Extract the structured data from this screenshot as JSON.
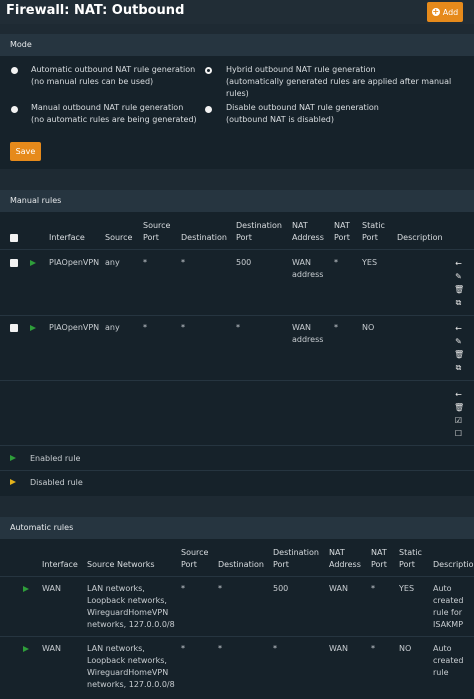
{
  "header": {
    "title": "Firewall: NAT: Outbound",
    "add_label": "Add"
  },
  "mode": {
    "title": "Mode",
    "options": [
      {
        "line1": "Automatic outbound NAT rule generation",
        "line2": "(no manual rules can be used)",
        "checked": false
      },
      {
        "line1": "Hybrid outbound NAT rule generation",
        "line2": "(automatically generated rules are applied after manual rules)",
        "checked": true
      },
      {
        "line1": "Manual outbound NAT rule generation",
        "line2": "(no automatic rules are being generated)",
        "checked": false
      },
      {
        "line1": "Disable outbound NAT rule generation",
        "line2": "(outbound NAT is disabled)",
        "checked": false
      }
    ],
    "save_label": "Save"
  },
  "manual": {
    "title": "Manual rules",
    "headers": {
      "interface": "Interface",
      "source": "Source",
      "source_port_1": "Source",
      "source_port_2": "Port",
      "destination": "Destination",
      "dest_port_1": "Destination",
      "dest_port_2": "Port",
      "nat_address_1": "NAT",
      "nat_address_2": "Address",
      "nat_port_1": "NAT",
      "nat_port_2": "Port",
      "static_port_1": "Static",
      "static_port_2": "Port",
      "description": "Description"
    },
    "rows": [
      {
        "interface": "PIAOpenVPN",
        "source": "any",
        "source_port": "*",
        "destination": "*",
        "dest_port": "500",
        "nat_address_1": "WAN",
        "nat_address_2": "address",
        "nat_port": "*",
        "static_port": "YES"
      },
      {
        "interface": "PIAOpenVPN",
        "source": "any",
        "source_port": "*",
        "destination": "*",
        "dest_port": "*",
        "nat_address_1": "WAN",
        "nat_address_2": "address",
        "nat_port": "*",
        "static_port": "NO"
      }
    ],
    "legend": {
      "enabled": "Enabled rule",
      "disabled": "Disabled rule"
    }
  },
  "automatic": {
    "title": "Automatic rules",
    "headers": {
      "interface": "Interface",
      "source_networks": "Source Networks",
      "source_port_1": "Source",
      "source_port_2": "Port",
      "destination": "Destination",
      "dest_port_1": "Destination",
      "dest_port_2": "Port",
      "nat_address_1": "NAT",
      "nat_address_2": "Address",
      "nat_port_1": "NAT",
      "nat_port_2": "Port",
      "static_port_1": "Static",
      "static_port_2": "Port",
      "description": "Description"
    },
    "rows": [
      {
        "interface": "WAN",
        "src_1": "LAN networks,",
        "src_2": "Loopback networks,",
        "src_3": "WireguardHomeVPN",
        "src_4": "networks, 127.0.0.0/8",
        "source_port": "*",
        "destination": "*",
        "dest_port": "500",
        "nat_address": "WAN",
        "nat_port": "*",
        "static_port": "YES",
        "desc_1": "Auto",
        "desc_2": "created",
        "desc_3": "rule for",
        "desc_4": "ISAKMP"
      },
      {
        "interface": "WAN",
        "src_1": "LAN networks,",
        "src_2": "Loopback networks,",
        "src_3": "WireguardHomeVPN",
        "src_4": "networks, 127.0.0.0/8",
        "source_port": "*",
        "destination": "*",
        "dest_port": "*",
        "nat_address": "WAN",
        "nat_port": "*",
        "static_port": "NO",
        "desc_1": "Auto",
        "desc_2": "created",
        "desc_3": "rule",
        "desc_4": ""
      }
    ]
  },
  "colors": {
    "accent": "#e68a1b",
    "enabled": "#2e9e3a",
    "disabled": "#e3b21b",
    "panel": "#16222a",
    "header": "#263540"
  }
}
